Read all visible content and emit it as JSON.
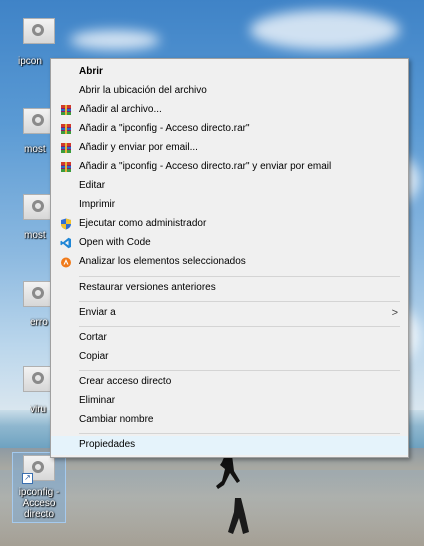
{
  "desktop": {
    "icons": [
      {
        "label": "ipcon"
      },
      {
        "label": "most"
      },
      {
        "label": "most"
      },
      {
        "label": "erro"
      },
      {
        "label": "viru"
      },
      {
        "label": "ipconfig - Acceso directo"
      }
    ]
  },
  "context_menu": {
    "items": [
      {
        "label": "Abrir",
        "icon": ""
      },
      {
        "label": "Abrir la ubicación del archivo",
        "icon": ""
      },
      {
        "label": "Añadir al archivo...",
        "icon": "winrar-icon"
      },
      {
        "label": "Añadir a \"ipconfig - Acceso directo.rar\"",
        "icon": "winrar-icon"
      },
      {
        "label": "Añadir y enviar por email...",
        "icon": "winrar-icon"
      },
      {
        "label": "Añadir a \"ipconfig - Acceso directo.rar\" y enviar por email",
        "icon": "winrar-icon"
      },
      {
        "label": "Editar",
        "icon": ""
      },
      {
        "label": "Imprimir",
        "icon": ""
      },
      {
        "label": "Ejecutar como administrador",
        "icon": "uac-shield-icon"
      },
      {
        "label": "Open with Code",
        "icon": "vscode-icon"
      },
      {
        "label": "Analizar los elementos seleccionados",
        "icon": "avast-icon"
      },
      {
        "label": "Restaurar versiones anteriores",
        "icon": ""
      },
      {
        "label": "Enviar a",
        "icon": ""
      },
      {
        "label": "Cortar",
        "icon": ""
      },
      {
        "label": "Copiar",
        "icon": ""
      },
      {
        "label": "Crear acceso directo",
        "icon": ""
      },
      {
        "label": "Eliminar",
        "icon": ""
      },
      {
        "label": "Cambiar nombre",
        "icon": ""
      },
      {
        "label": "Propiedades",
        "icon": ""
      }
    ],
    "submenu_arrow": ">"
  },
  "colors": {
    "menu_bg": "#f0f0f0",
    "hover_bg": "#e5f3fb",
    "separator": "#d4d4d4"
  }
}
